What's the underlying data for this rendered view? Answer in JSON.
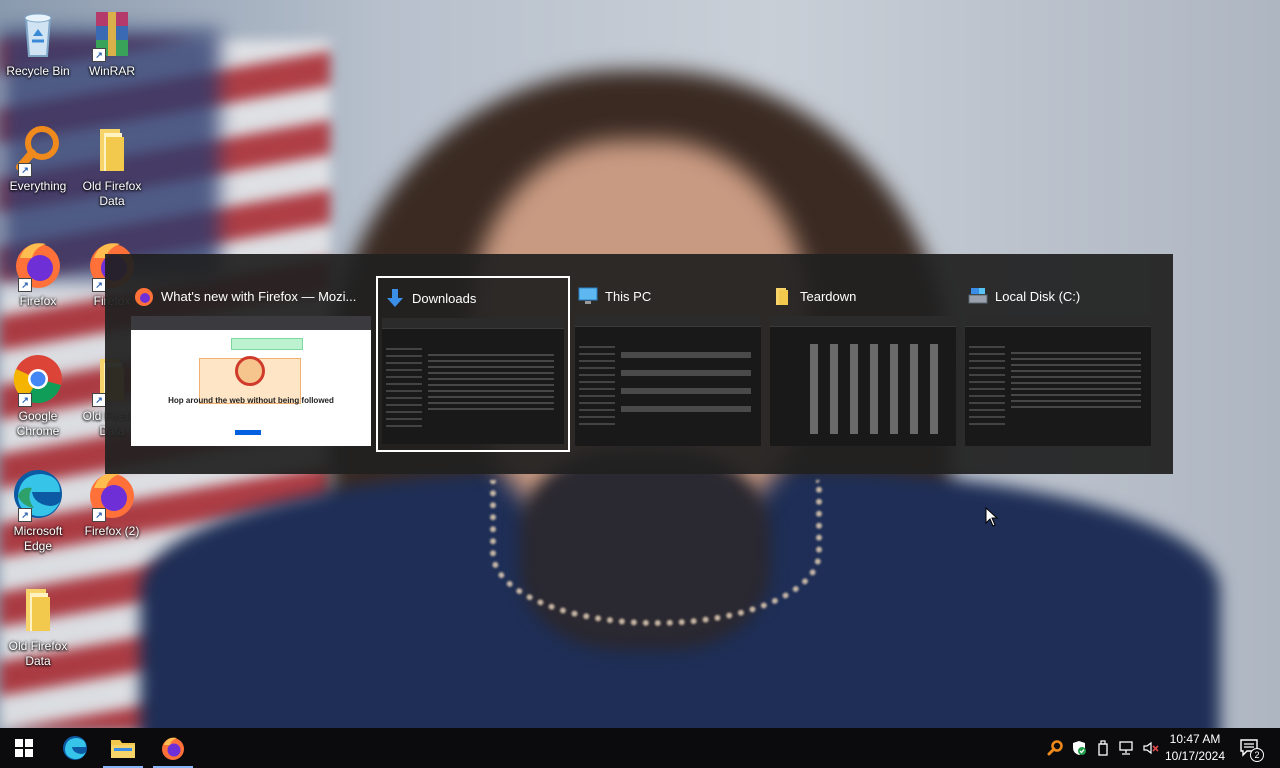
{
  "desktop": {
    "icons": [
      {
        "label": "Recycle Bin"
      },
      {
        "label": "WinRAR"
      },
      {
        "label": "Everything"
      },
      {
        "label": "Old Firefox Data"
      },
      {
        "label": "Firefox"
      },
      {
        "label": "Firefox"
      },
      {
        "label": "Google Chrome"
      },
      {
        "label": "Old Firefox Data"
      },
      {
        "label": "Microsoft Edge"
      },
      {
        "label": "Firefox (2)"
      },
      {
        "label": "Old Firefox Data"
      }
    ]
  },
  "switcher": {
    "tasks": [
      {
        "title": "What's new with Firefox — Mozi...",
        "icon": "firefox-icon",
        "selected": false,
        "preview": {
          "badge": "",
          "headline": "Hop around the web without being followed"
        }
      },
      {
        "title": "Downloads",
        "icon": "download-folder-icon",
        "selected": true
      },
      {
        "title": "This PC",
        "icon": "this-pc-icon",
        "selected": false
      },
      {
        "title": "Teardown",
        "icon": "folder-icon",
        "selected": false
      },
      {
        "title": "Local Disk (C:)",
        "icon": "drive-icon",
        "selected": false
      }
    ]
  },
  "taskbar": {
    "apps": [
      "start-icon",
      "edge-icon",
      "file-explorer-icon",
      "firefox-icon"
    ],
    "tray": [
      "everything-tray-icon",
      "security-icon",
      "usb-icon",
      "network-icon",
      "volume-muted-icon"
    ],
    "time": "10:47 AM",
    "date": "10/17/2024",
    "notifications_count": "2"
  },
  "colors": {
    "accent": "#8ab4f8",
    "switcher_bg": "#202020"
  }
}
